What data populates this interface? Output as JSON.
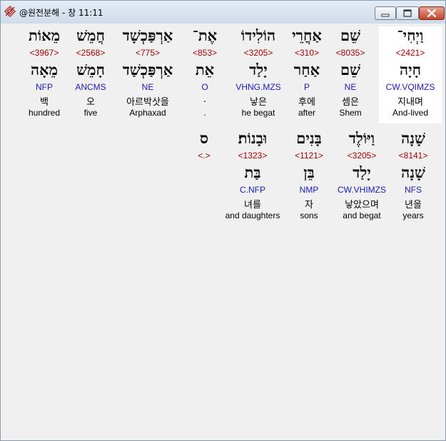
{
  "window": {
    "title": "@원전분해 - 창 11:11"
  },
  "rows": [
    {
      "words": [
        {
          "heb": "וַיְחִי־",
          "strong": "<2421>",
          "root": "חָיָה",
          "parse": "CW.VQIMZS",
          "ko": "지내며",
          "en": "And-lived",
          "highlight": true
        },
        {
          "heb": "שֵׁם",
          "strong": "<8035>",
          "root": "שֵׁם",
          "parse": "NE",
          "ko": "셈은",
          "en": "Shem"
        },
        {
          "heb": "אַחֲרֵי",
          "strong": "<310>",
          "root": "אַחַר",
          "parse": "P",
          "ko": "후에",
          "en": "after"
        },
        {
          "heb": "הוֹלִידוֹ",
          "strong": "<3205>",
          "root": "יָלַד",
          "parse": "VHNG.MZS",
          "ko": "낳은",
          "en": "he begat"
        },
        {
          "heb": "אֶת־",
          "strong": "<853>",
          "root": "אֵת",
          "parse": "O",
          "ko": ".",
          "en": "."
        },
        {
          "heb": "אַרְפַּכְשָׁד",
          "strong": "<775>",
          "root": "אַרְפַּכְשַׁד",
          "parse": "NE",
          "ko": "아르박삿을",
          "en": "Arphaxad"
        },
        {
          "heb": "חֲמֵשׁ",
          "strong": "<2568>",
          "root": "חָמֵשׁ",
          "parse": "ANCMS",
          "ko": "오",
          "en": "five"
        },
        {
          "heb": "מֵאוֹת",
          "strong": "<3967>",
          "root": "מֵאָה",
          "parse": "NFP",
          "ko": "백",
          "en": "hundred"
        }
      ]
    },
    {
      "words": [
        {
          "heb": "שָׁנָה",
          "strong": "<8141>",
          "root": "שָׁנָה",
          "parse": "NFS",
          "ko": "년을",
          "en": "years"
        },
        {
          "heb": "וַיּוֹלֶד",
          "strong": "<3205>",
          "root": "יָלַד",
          "parse": "CW.VHIMZS",
          "ko": "낳았으며",
          "en": "and begat"
        },
        {
          "heb": "בָּנִים",
          "strong": "<1121>",
          "root": "בֵּן",
          "parse": "NMP",
          "ko": "자",
          "en": "sons"
        },
        {
          "heb": "וּבָנוֹת׃",
          "strong": "<1323>",
          "root": "בַּת",
          "parse": "C.NFP",
          "ko": "녀를",
          "en": "and daughters"
        },
        {
          "heb": "ס",
          "strong": "<.>",
          "root": "",
          "parse": "",
          "ko": "",
          "en": ""
        }
      ]
    }
  ]
}
